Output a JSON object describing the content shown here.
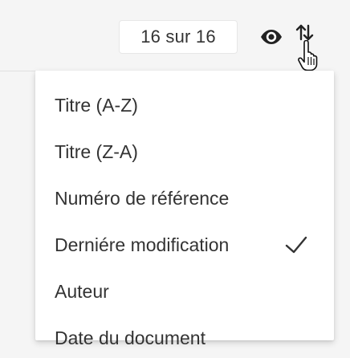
{
  "toolbar": {
    "result_count": "16 sur 16",
    "view_icon": "eye-icon",
    "sort_icon": "sort-icon",
    "cursor_icon": "hand-pointer-icon"
  },
  "sort_menu": {
    "items": [
      {
        "label": "Titre (A-Z)",
        "selected": false
      },
      {
        "label": "Titre (Z-A)",
        "selected": false
      },
      {
        "label": "Numéro de référence",
        "selected": false
      },
      {
        "label": "Derniére modification",
        "selected": true
      },
      {
        "label": "Auteur",
        "selected": false
      },
      {
        "label": "Date du document",
        "selected": false
      }
    ],
    "check_icon": "checkmark-icon"
  },
  "colors": {
    "text": "#333333",
    "background": "#f5f5f5",
    "menu_background": "#ffffff",
    "icon": "#222222"
  }
}
